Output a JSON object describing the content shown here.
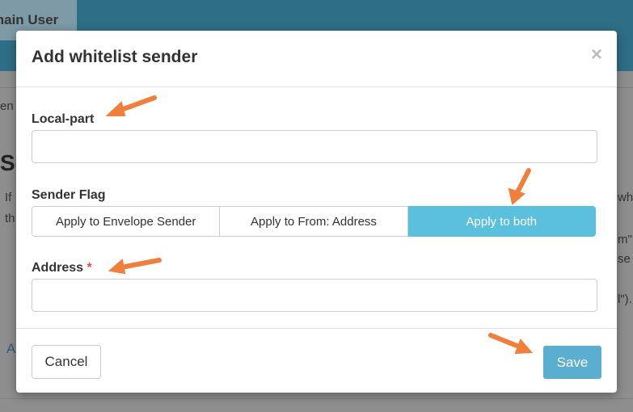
{
  "background": {
    "tab_label": "main User",
    "snippets": [
      "en",
      "Se",
      "If",
      "th",
      "wh",
      "m\"",
      "se",
      "l\").",
      "A"
    ]
  },
  "modal": {
    "title": "Add whitelist sender",
    "close_glyph": "×",
    "local_part": {
      "label": "Local-part",
      "value": "",
      "placeholder": ""
    },
    "sender_flag": {
      "label": "Sender Flag",
      "options": [
        "Apply to Envelope Sender",
        "Apply to From: Address",
        "Apply to both"
      ],
      "selected": "Apply to both"
    },
    "address": {
      "label": "Address",
      "required_mark": "*",
      "value": "",
      "placeholder": ""
    },
    "cancel_label": "Cancel",
    "save_label": "Save"
  },
  "colors": {
    "accent": "#5bc0de",
    "save_button": "#5aaed0",
    "annotation_arrow": "#f07f3c",
    "topbar": "#2e6e86"
  },
  "annotations": [
    "arrow-icon",
    "arrow-icon",
    "arrow-icon",
    "arrow-icon",
    "arrow-icon"
  ]
}
